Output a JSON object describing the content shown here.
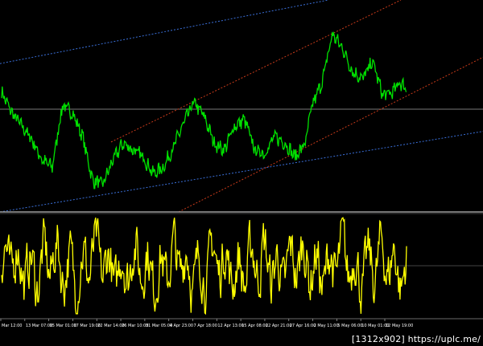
{
  "chart_data": [
    {
      "type": "line",
      "panel": "price",
      "series_color": "#00e000",
      "grid": false,
      "channel_upper_blue_color": "#3a6fd8",
      "channel_lower_blue_color": "#3a6fd8",
      "channel_red_color": "#c83a1a",
      "horizontal_level_color": "#7a7a7a",
      "ylim": [
        0,
        100
      ],
      "level": 50,
      "anchors": [
        [
          0,
          60
        ],
        [
          3,
          48
        ],
        [
          6,
          40
        ],
        [
          9,
          32
        ],
        [
          12,
          20
        ],
        [
          15,
          16
        ],
        [
          18,
          52
        ],
        [
          21,
          48
        ],
        [
          24,
          34
        ],
        [
          27,
          8
        ],
        [
          30,
          6
        ],
        [
          33,
          20
        ],
        [
          36,
          30
        ],
        [
          39,
          26
        ],
        [
          42,
          22
        ],
        [
          45,
          12
        ],
        [
          48,
          16
        ],
        [
          51,
          28
        ],
        [
          54,
          42
        ],
        [
          57,
          54
        ],
        [
          60,
          46
        ],
        [
          63,
          30
        ],
        [
          66,
          26
        ],
        [
          69,
          40
        ],
        [
          72,
          44
        ],
        [
          75,
          26
        ],
        [
          78,
          24
        ],
        [
          81,
          34
        ],
        [
          84,
          30
        ],
        [
          87,
          22
        ],
        [
          90,
          30
        ],
        [
          92,
          52
        ],
        [
          95,
          66
        ],
        [
          98,
          94
        ],
        [
          101,
          86
        ],
        [
          104,
          72
        ],
        [
          107,
          68
        ],
        [
          110,
          78
        ],
        [
          113,
          58
        ],
        [
          116,
          60
        ],
        [
          118,
          66
        ],
        [
          120,
          62
        ]
      ]
    },
    {
      "type": "line",
      "panel": "oscillator",
      "series_color": "#ffff00",
      "grid": false,
      "ylim": [
        -100,
        100
      ],
      "level": 0,
      "level_color": "#888888"
    }
  ],
  "x_ticks": [
    "Mar 12:00",
    "13 Mar 07:00",
    "15 Mar 01:00",
    "17 Mar 19:00",
    "22 Mar 14:00",
    "26 Mar 10:00",
    "31 Mar 05:00",
    "4 Apr 23:00",
    "7 Apr 18:00",
    "12 Apr 13:00",
    "15 Apr 08:00",
    "22 Apr 21:00",
    "27 Apr 16:00",
    "2 May 11:00",
    "5 May 06:00",
    "10 May 01:00",
    "12 May 19:00"
  ],
  "watermark": "[1312x902] https://uplc.me/"
}
